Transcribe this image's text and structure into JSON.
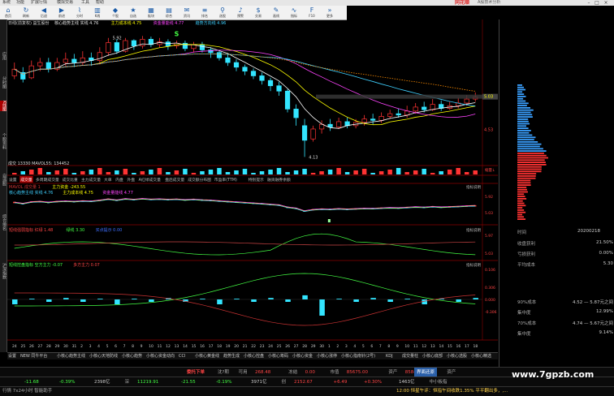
{
  "titlebar": {
    "menu": [
      "系统",
      "功能",
      "扩展行情",
      "模拟交易",
      "工具",
      "帮助"
    ],
    "brand": "同花顺",
    "brand_sub": "A股技术分析"
  },
  "toolbar": {
    "buttons": [
      {
        "label": "首页",
        "icon": "home-icon"
      },
      {
        "label": "刷新",
        "icon": "refresh-icon"
      },
      {
        "label": "后退",
        "icon": "back-icon"
      },
      {
        "label": "前进",
        "icon": "forward-icon"
      },
      {
        "label": "分时",
        "icon": "timeline-icon"
      },
      {
        "label": "K线",
        "icon": "kline-icon"
      },
      {
        "label": "个股",
        "icon": "stock-icon"
      },
      {
        "label": "自选",
        "icon": "star-icon"
      },
      {
        "label": "板块",
        "icon": "sector-icon"
      },
      {
        "label": "综合",
        "icon": "grid-icon"
      },
      {
        "label": "资讯",
        "icon": "news-icon"
      },
      {
        "label": "排名",
        "icon": "rank-icon"
      },
      {
        "label": "选股",
        "icon": "filter-icon"
      },
      {
        "label": "预警",
        "icon": "bell-icon"
      },
      {
        "label": "交易",
        "icon": "trade-icon"
      },
      {
        "label": "画线",
        "icon": "pen-icon"
      },
      {
        "label": "指标",
        "icon": "indicator-icon"
      },
      {
        "label": "F10",
        "icon": "doc-icon"
      },
      {
        "label": "更多",
        "icon": "more-icon"
      }
    ]
  },
  "sidebar": {
    "tabs": [
      "应用",
      "分时图",
      "K线图",
      "个股资料",
      "自选股",
      "综合排名",
      "沪深指数"
    ]
  },
  "main_chart": {
    "header_left": "日线(前复权)  益生股份",
    "legend": [
      {
        "text": "核心趋势主线 实线 4.76",
        "color": "#e6e6e6"
      },
      {
        "text": "主力成本线 4.75",
        "color": "#ffff00"
      },
      {
        "text": "资金量能线 4.77",
        "color": "#ff44ff"
      },
      {
        "text": "趋势方向线 4.96",
        "color": "#3fd0ff"
      }
    ],
    "high_label": "5.92",
    "low_label": "4.13",
    "mark_s": "S",
    "right_labels": [
      "5.03",
      "4.53"
    ]
  },
  "volume_chart": {
    "header": "成交  13330  MAVOL55: 134452",
    "right_label": "缩量↓"
  },
  "indicator_tabs": [
    "设置",
    "成交量",
    "多周期成交量",
    "成交比重",
    "主力成交量",
    "大单",
    "内盘",
    "外盘",
    "A红绿成交量",
    "盘后成交量",
    "成交额分布图",
    "市盈率(TTM)",
    "特别提示",
    "融资融券余额"
  ],
  "panel1": {
    "header_parts": [
      {
        "text": "MAVOL 成交量 1",
        "color": "#cc3333"
      },
      {
        "text": "主力资金 -243.55",
        "color": "#ffff00"
      }
    ],
    "header2_parts": [
      {
        "text": "核心趋势主线 实线 4.76",
        "color": "#3fd0ff"
      },
      {
        "text": "主力成本线 4.75",
        "color": "#ffff00"
      },
      {
        "text": "资金量能线 4.77",
        "color": "#ff44ff"
      }
    ],
    "right_tag": "指标说明",
    "right_labels": [
      "5.92",
      "5.03"
    ]
  },
  "panel2": {
    "header_parts": [
      {
        "text": "短线强弱指标 红绿  1.48",
        "color": "#ff4444"
      },
      {
        "text": "绿线 3.30",
        "color": "#44ff44"
      },
      {
        "text": "买点提示 0.00",
        "color": "#3f6fff"
      }
    ],
    "right_tag": "指标说明",
    "right_labels": [
      "5.97",
      "5.03"
    ]
  },
  "panel3": {
    "header_parts": [
      {
        "text": "短线控盘指标 空方主力 -0.07",
        "color": "#44ff44"
      },
      {
        "text": "多方主力 0.07",
        "color": "#ff4444"
      }
    ],
    "right_tag": "指标说明",
    "right_labels": [
      "0.106",
      "0.306",
      "0.000",
      "-0.306"
    ]
  },
  "date_axis": [
    "24",
    "25",
    "26",
    "27",
    "28",
    "29",
    "30",
    "31",
    "2",
    "3",
    "4",
    "5",
    "6",
    "7",
    "8",
    "9",
    "10",
    "11",
    "12",
    "13",
    "14",
    "15",
    "16",
    "17",
    "18",
    "19",
    "20",
    "21",
    "22",
    "23",
    "24",
    "25",
    "26",
    "27",
    "28",
    "29",
    "30",
    "1",
    "2",
    "3",
    "4",
    "5",
    "6",
    "7",
    "8",
    "9",
    "10",
    "11",
    "12",
    "13",
    "14",
    "15",
    "16",
    "17",
    "18"
  ],
  "bottom_tabs": [
    "设置",
    "NEW 同牛平台",
    "小核心趋势主线",
    "小核心天地防线",
    "小核心趋势",
    "小核心资金动向",
    "CCI",
    "小核心黄金线",
    "趋势生成",
    "小核心控盘",
    "小核心筹码",
    "小核心资金",
    "小核心涨停",
    "小核心指南针(2号)",
    "KDJ",
    "成交量柱",
    "小核心底部",
    "小核心选股",
    "小核心精选",
    "小核心主力",
    "小核心强势",
    "小核心趋势",
    "小核心筹码",
    "小核心资金",
    "小核心涨停主升",
    "小核心天地防线",
    "小核心控盘",
    "筹码分布",
    "主力资金",
    "新股申购"
  ],
  "right_panel": {
    "label_top": "时间",
    "date": "20200218",
    "rows": [
      {
        "k": "收盘获利",
        "v": "21.50%"
      },
      {
        "k": "亏损获利",
        "v": "0.00%"
      },
      {
        "k": "平均成本",
        "v": "5.30"
      }
    ],
    "rows2": [
      {
        "k": "90%成本",
        "v": "4.52 — 5.87元之间"
      },
      {
        "k": "集中度",
        "v": "12.99%"
      },
      {
        "k": "70%成本",
        "v": "4.74 — 5.67元之间"
      },
      {
        "k": "集中度",
        "v": "9.14%"
      }
    ]
  },
  "order_bar": {
    "left": "委托下单",
    "items": [
      "沈?期",
      "可用",
      "268.48",
      "冻结",
      "0.00",
      "市值",
      "85675.00",
      "资产",
      "85843.48",
      "资产"
    ],
    "btn": "界面还原"
  },
  "index_bar": [
    {
      "v": "-11.68",
      "c": "#44ff44"
    },
    {
      "v": "-0.39%",
      "c": "#44ff44"
    },
    {
      "v": "2398亿",
      "c": "#ccc"
    },
    {
      "v": "深",
      "c": "#aaa"
    },
    {
      "v": "11219.91",
      "c": "#44ff44"
    },
    {
      "v": "-21.55",
      "c": "#44ff44"
    },
    {
      "v": "-0.19%",
      "c": "#44ff44"
    },
    {
      "v": "3971亿",
      "c": "#ccc"
    },
    {
      "v": "创",
      "c": "#aaa"
    },
    {
      "v": "2152.67",
      "c": "#ff4444"
    },
    {
      "v": "+6.49",
      "c": "#ff4444"
    },
    {
      "v": "+0.30%",
      "c": "#ff4444"
    },
    {
      "v": "1463亿",
      "c": "#ccc"
    },
    {
      "v": "中小板指",
      "c": "#aaa"
    }
  ],
  "statusbar": {
    "left": "行情 7x24小时  智能助手",
    "ticker": "12:00 恒星午评：恒指午间收跌1.35% 平平翻出多，,...",
    "watermark": "www.7gpzb.com"
  }
}
